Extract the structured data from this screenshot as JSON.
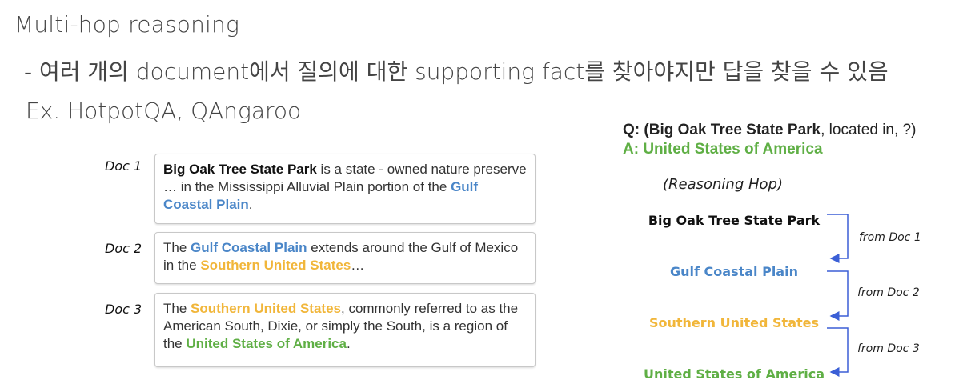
{
  "heading": {
    "title": "Multi-hop reasoning",
    "subline": "- 여러 개의 document에서 질의에 대한 supporting fact를 찾아야지만 답을 찾을 수 있음",
    "example": "Ex. HotpotQA, QAngaroo"
  },
  "docs": [
    {
      "label": "Doc 1",
      "segments": [
        {
          "text": "Big Oak Tree State Park",
          "style": "black"
        },
        {
          "text": " is a state - owned nature preserve … in the Mississippi Alluvial Plain portion of the ",
          "style": "plain"
        },
        {
          "text": "Gulf Coastal Plain",
          "style": "blue"
        },
        {
          "text": ".",
          "style": "plain"
        }
      ]
    },
    {
      "label": "Doc 2",
      "segments": [
        {
          "text": "The ",
          "style": "plain"
        },
        {
          "text": "Gulf Coastal Plain",
          "style": "blue"
        },
        {
          "text": " extends around the Gulf of Mexico in the ",
          "style": "plain"
        },
        {
          "text": "Southern United States",
          "style": "yellow"
        },
        {
          "text": "…",
          "style": "plain"
        }
      ]
    },
    {
      "label": "Doc 3",
      "segments": [
        {
          "text": "The ",
          "style": "plain"
        },
        {
          "text": "Southern United States",
          "style": "yellow"
        },
        {
          "text": ", commonly referred to as the American South, Dixie, or simply the South, is a region of the ",
          "style": "plain"
        },
        {
          "text": "United States of America",
          "style": "green"
        },
        {
          "text": ".",
          "style": "plain"
        }
      ]
    }
  ],
  "question": {
    "prefix": "Q:  (",
    "entity": "Big Oak Tree State Park",
    "suffix": ", located in, ?)"
  },
  "answer": "A: United States of America",
  "hops": {
    "title": "(Reasoning Hop)",
    "nodes": [
      {
        "label": "Big Oak Tree State Park",
        "style": "black"
      },
      {
        "label": "Gulf Coastal Plain",
        "style": "blue"
      },
      {
        "label": "Southern United States",
        "style": "yellow"
      },
      {
        "label": "United States of America",
        "style": "green"
      }
    ],
    "edges": [
      "from Doc 1",
      "from Doc 2",
      "from Doc 3"
    ]
  },
  "colors": {
    "blue": "#4a86c8",
    "yellow": "#f1b63a",
    "green": "#5faf45",
    "arrow": "#3b5fd6"
  }
}
